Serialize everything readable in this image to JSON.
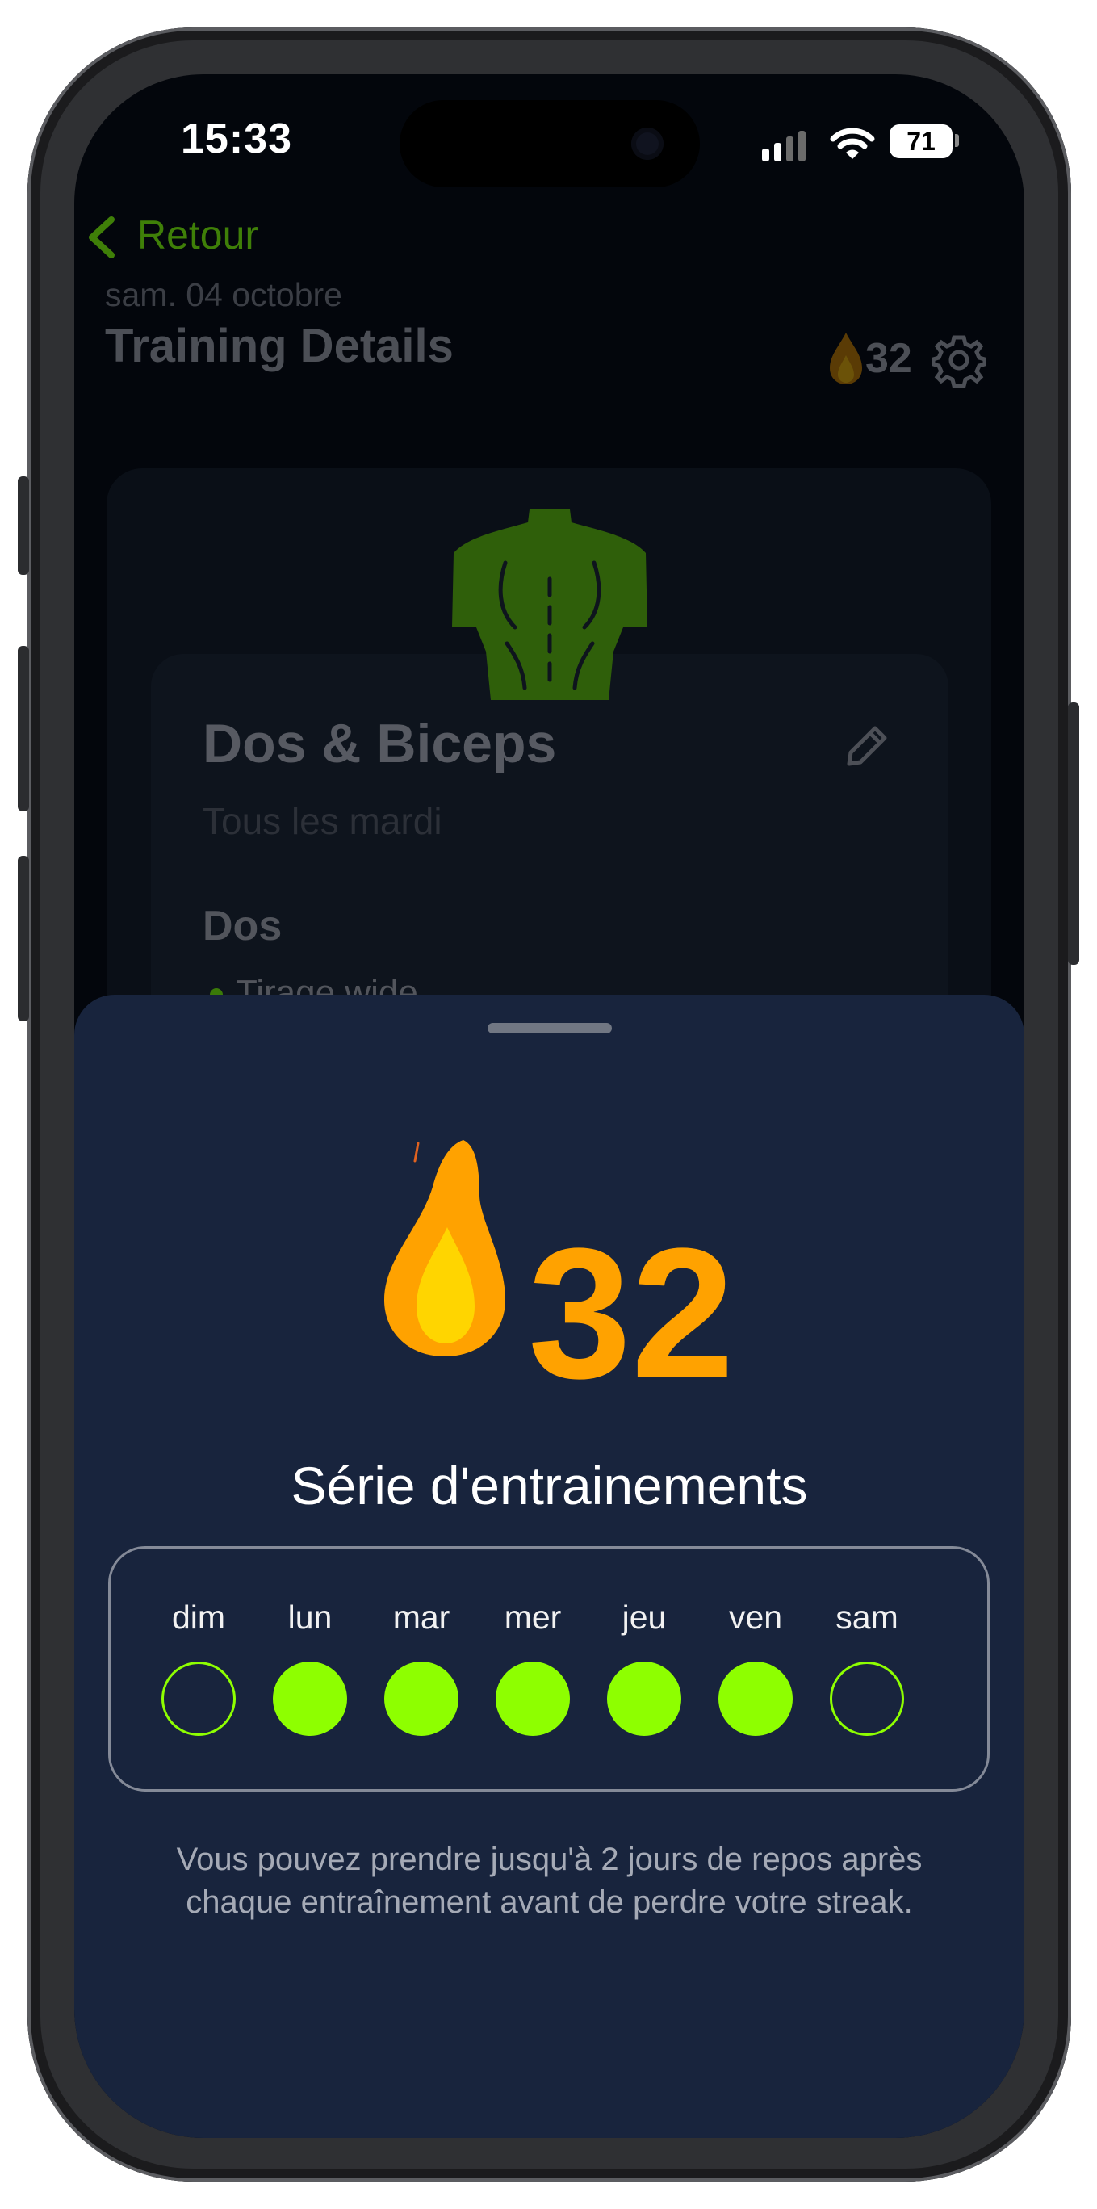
{
  "status_bar": {
    "time": "15:33",
    "battery": "71"
  },
  "nav": {
    "back_label": "Retour"
  },
  "header": {
    "date": "sam. 04 octobre",
    "title": "Training Details",
    "streak_count": "32"
  },
  "workout": {
    "name": "Dos & Biceps",
    "schedule": "Tous les mardi",
    "section": "Dos",
    "first_exercise": "Tirage wide"
  },
  "streak_sheet": {
    "count": "32",
    "title": "Série d'entrainements",
    "days": [
      {
        "label": "dim",
        "done": false
      },
      {
        "label": "lun",
        "done": true
      },
      {
        "label": "mar",
        "done": true
      },
      {
        "label": "mer",
        "done": true
      },
      {
        "label": "jeu",
        "done": true
      },
      {
        "label": "ven",
        "done": true
      },
      {
        "label": "sam",
        "done": false
      }
    ],
    "hint": "Vous pouvez prendre jusqu'à 2 jours de repos après chaque entraînement avant de perdre votre streak."
  },
  "colors": {
    "accent": "#8eff00",
    "flame": "#ffa200",
    "sheet_bg": "#18243d"
  },
  "icons": [
    "chevron-left-icon",
    "flame-icon",
    "gear-icon",
    "pencil-icon",
    "back-muscles-icon",
    "signal-icon",
    "wifi-icon",
    "battery-icon"
  ]
}
